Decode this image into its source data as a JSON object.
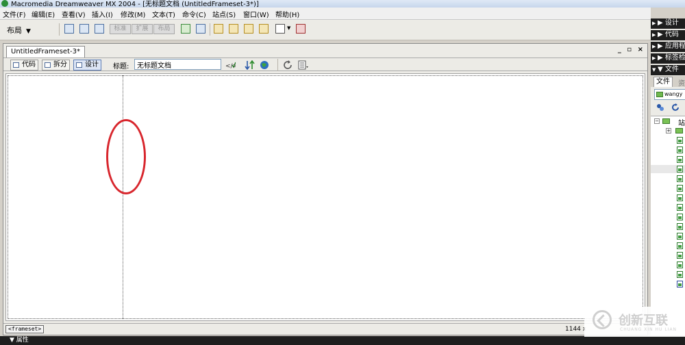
{
  "window": {
    "title": "Macromedia Dreamweaver MX 2004 - [无标题文档 (UntitledFrameset-3*)]"
  },
  "menubar": {
    "items": [
      "文件(F)",
      "编辑(E)",
      "查看(V)",
      "插入(I)",
      "修改(M)",
      "文本(T)",
      "命令(C)",
      "站点(S)",
      "窗口(W)",
      "帮助(H)"
    ]
  },
  "toolbar": {
    "layout_dropdown": "布局",
    "mode_buttons": [
      "标准",
      "扩展",
      "布局"
    ]
  },
  "document": {
    "tab_title": "UntitledFrameset-3*",
    "window_controls": [
      "_",
      "▫",
      "×"
    ],
    "view_buttons": [
      "代码",
      "拆分",
      "设计"
    ],
    "active_view": "设计",
    "title_label": "标题:",
    "title_value": "无标题文档"
  },
  "status": {
    "tag": "<frameset>",
    "size": "1144 x"
  },
  "properties_panel": {
    "label": "▼ 属性"
  },
  "right_panels": {
    "headers": [
      "▶ 设计",
      "▶ 代码",
      "▶ 应用程",
      "▶ 标签检",
      "▼ 文件"
    ],
    "files_tab": "文件",
    "files_tab_2": "资",
    "site_name": "wangy",
    "tree_root_label": "站"
  },
  "watermark": {
    "cn": "创新互联",
    "en": "CHUANG XIN HU LIAN"
  },
  "colors": {
    "highlight_circle": "#d8262d",
    "panel_header_bg": "#1e1e1e",
    "toolbar_bg": "#ecebe6"
  }
}
